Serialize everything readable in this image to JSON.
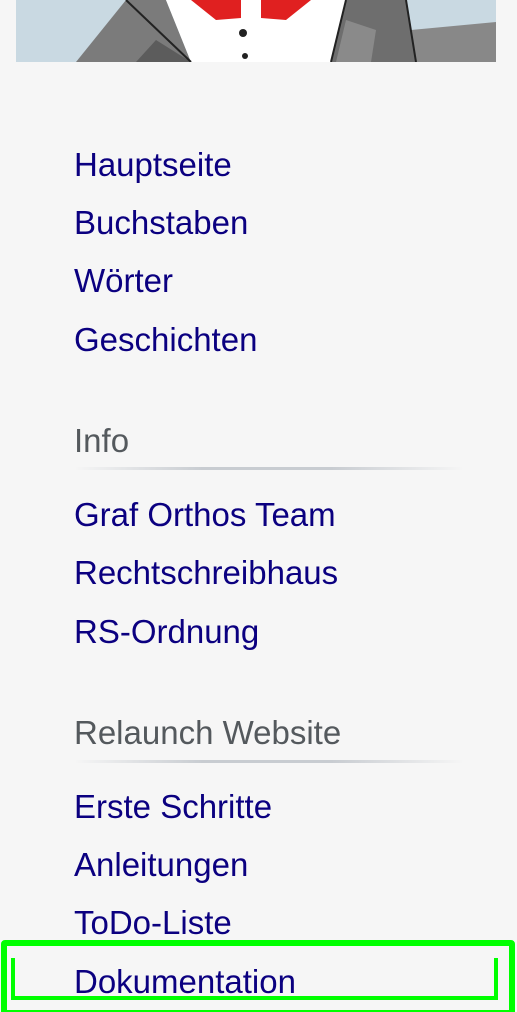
{
  "logo": {
    "icon": "graf-orthos-mascot-logo"
  },
  "navigation": {
    "items": [
      {
        "label": "Hauptseite"
      },
      {
        "label": "Buchstaben"
      },
      {
        "label": "Wörter"
      },
      {
        "label": "Geschichten"
      }
    ]
  },
  "info": {
    "heading": "Info",
    "items": [
      {
        "label": "Graf Orthos Team"
      },
      {
        "label": "Rechtschreibhaus"
      },
      {
        "label": "RS-Ordnung"
      }
    ]
  },
  "relaunch": {
    "heading": "Relaunch Website",
    "items": [
      {
        "label": "Erste Schritte"
      },
      {
        "label": "Anleitungen"
      },
      {
        "label": "ToDo-Liste"
      },
      {
        "label": "Dokumentation"
      }
    ]
  },
  "colors": {
    "link": "#0b0080",
    "heading": "#54595d",
    "background": "#f6f6f6",
    "highlight": "#00ff00"
  }
}
